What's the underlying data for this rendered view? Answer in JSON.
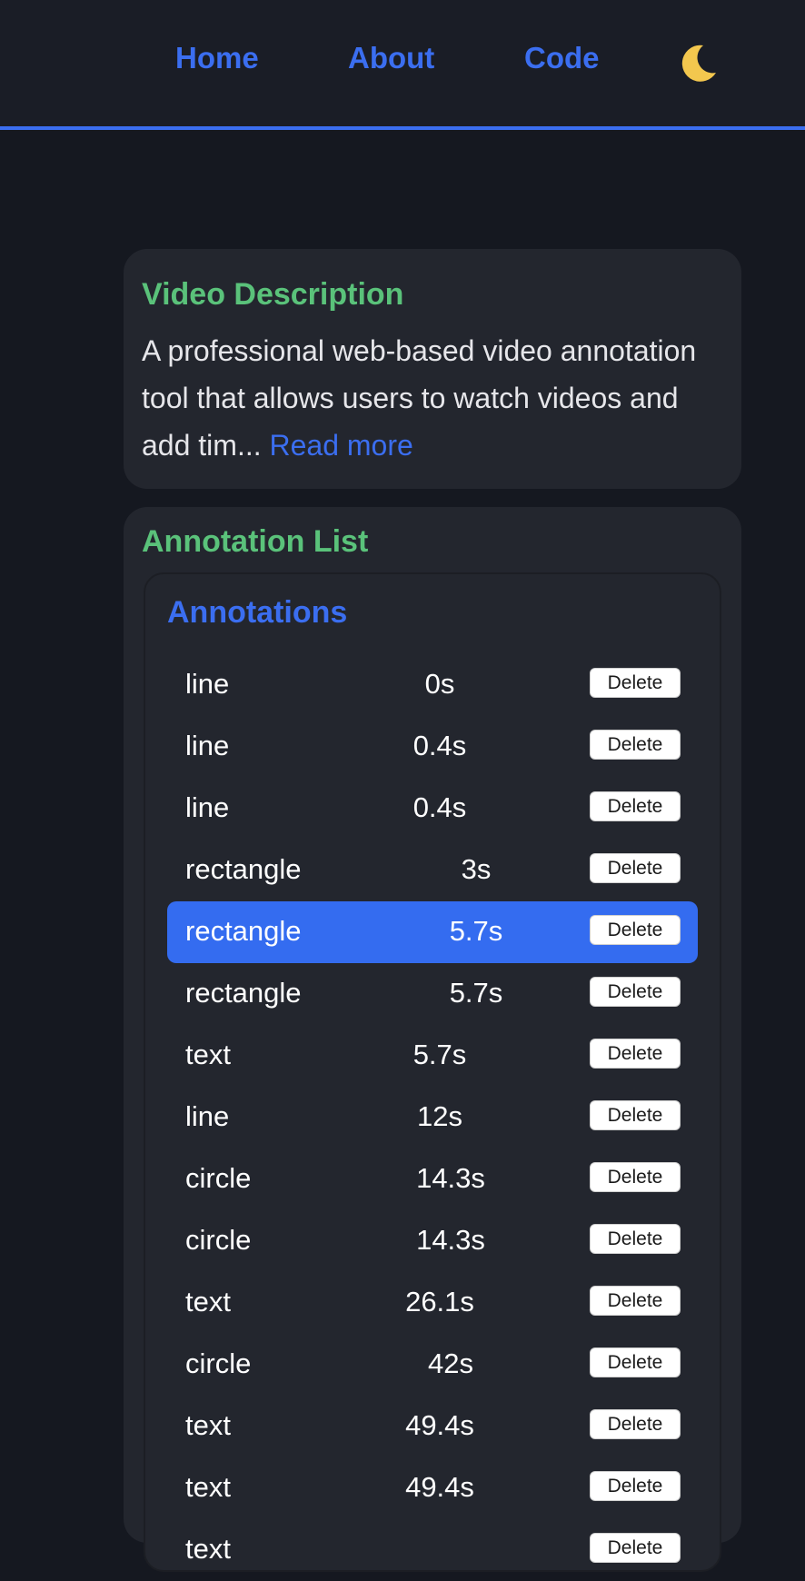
{
  "nav": {
    "home": "Home",
    "about": "About",
    "code": "Code",
    "theme_icon": "moon-icon"
  },
  "description": {
    "title": "Video Description",
    "text": "A professional web-based video annotation tool that allows users to watch videos and add tim...",
    "read_more": "Read more"
  },
  "annotation_list": {
    "title": "Annotation List",
    "header": "Annotations",
    "delete_label": "Delete",
    "items": [
      {
        "type": "line",
        "time": "0s",
        "offset": 0,
        "active": false
      },
      {
        "type": "line",
        "time": "0.4s",
        "offset": 0,
        "active": false
      },
      {
        "type": "line",
        "time": "0.4s",
        "offset": 0,
        "active": false
      },
      {
        "type": "rectangle",
        "time": "3s",
        "offset": 40,
        "active": false
      },
      {
        "type": "rectangle",
        "time": "5.7s",
        "offset": 40,
        "active": true
      },
      {
        "type": "rectangle",
        "time": "5.7s",
        "offset": 40,
        "active": false
      },
      {
        "type": "text",
        "time": "5.7s",
        "offset": 0,
        "active": false
      },
      {
        "type": "line",
        "time": "12s",
        "offset": 0,
        "active": false
      },
      {
        "type": "circle",
        "time": "14.3s",
        "offset": 12,
        "active": false
      },
      {
        "type": "circle",
        "time": "14.3s",
        "offset": 12,
        "active": false
      },
      {
        "type": "text",
        "time": "26.1s",
        "offset": 0,
        "active": false
      },
      {
        "type": "circle",
        "time": "42s",
        "offset": 12,
        "active": false
      },
      {
        "type": "text",
        "time": "49.4s",
        "offset": 0,
        "active": false
      },
      {
        "type": "text",
        "time": "49.4s",
        "offset": 0,
        "active": false
      },
      {
        "type": "text",
        "time": "",
        "offset": 0,
        "active": false
      }
    ]
  },
  "colors": {
    "background": "#151820",
    "navbar": "#1a1d26",
    "accent": "#3b6ef0",
    "card": "#23262e",
    "section_title": "#5ac27a",
    "active_row": "#346cf0"
  }
}
